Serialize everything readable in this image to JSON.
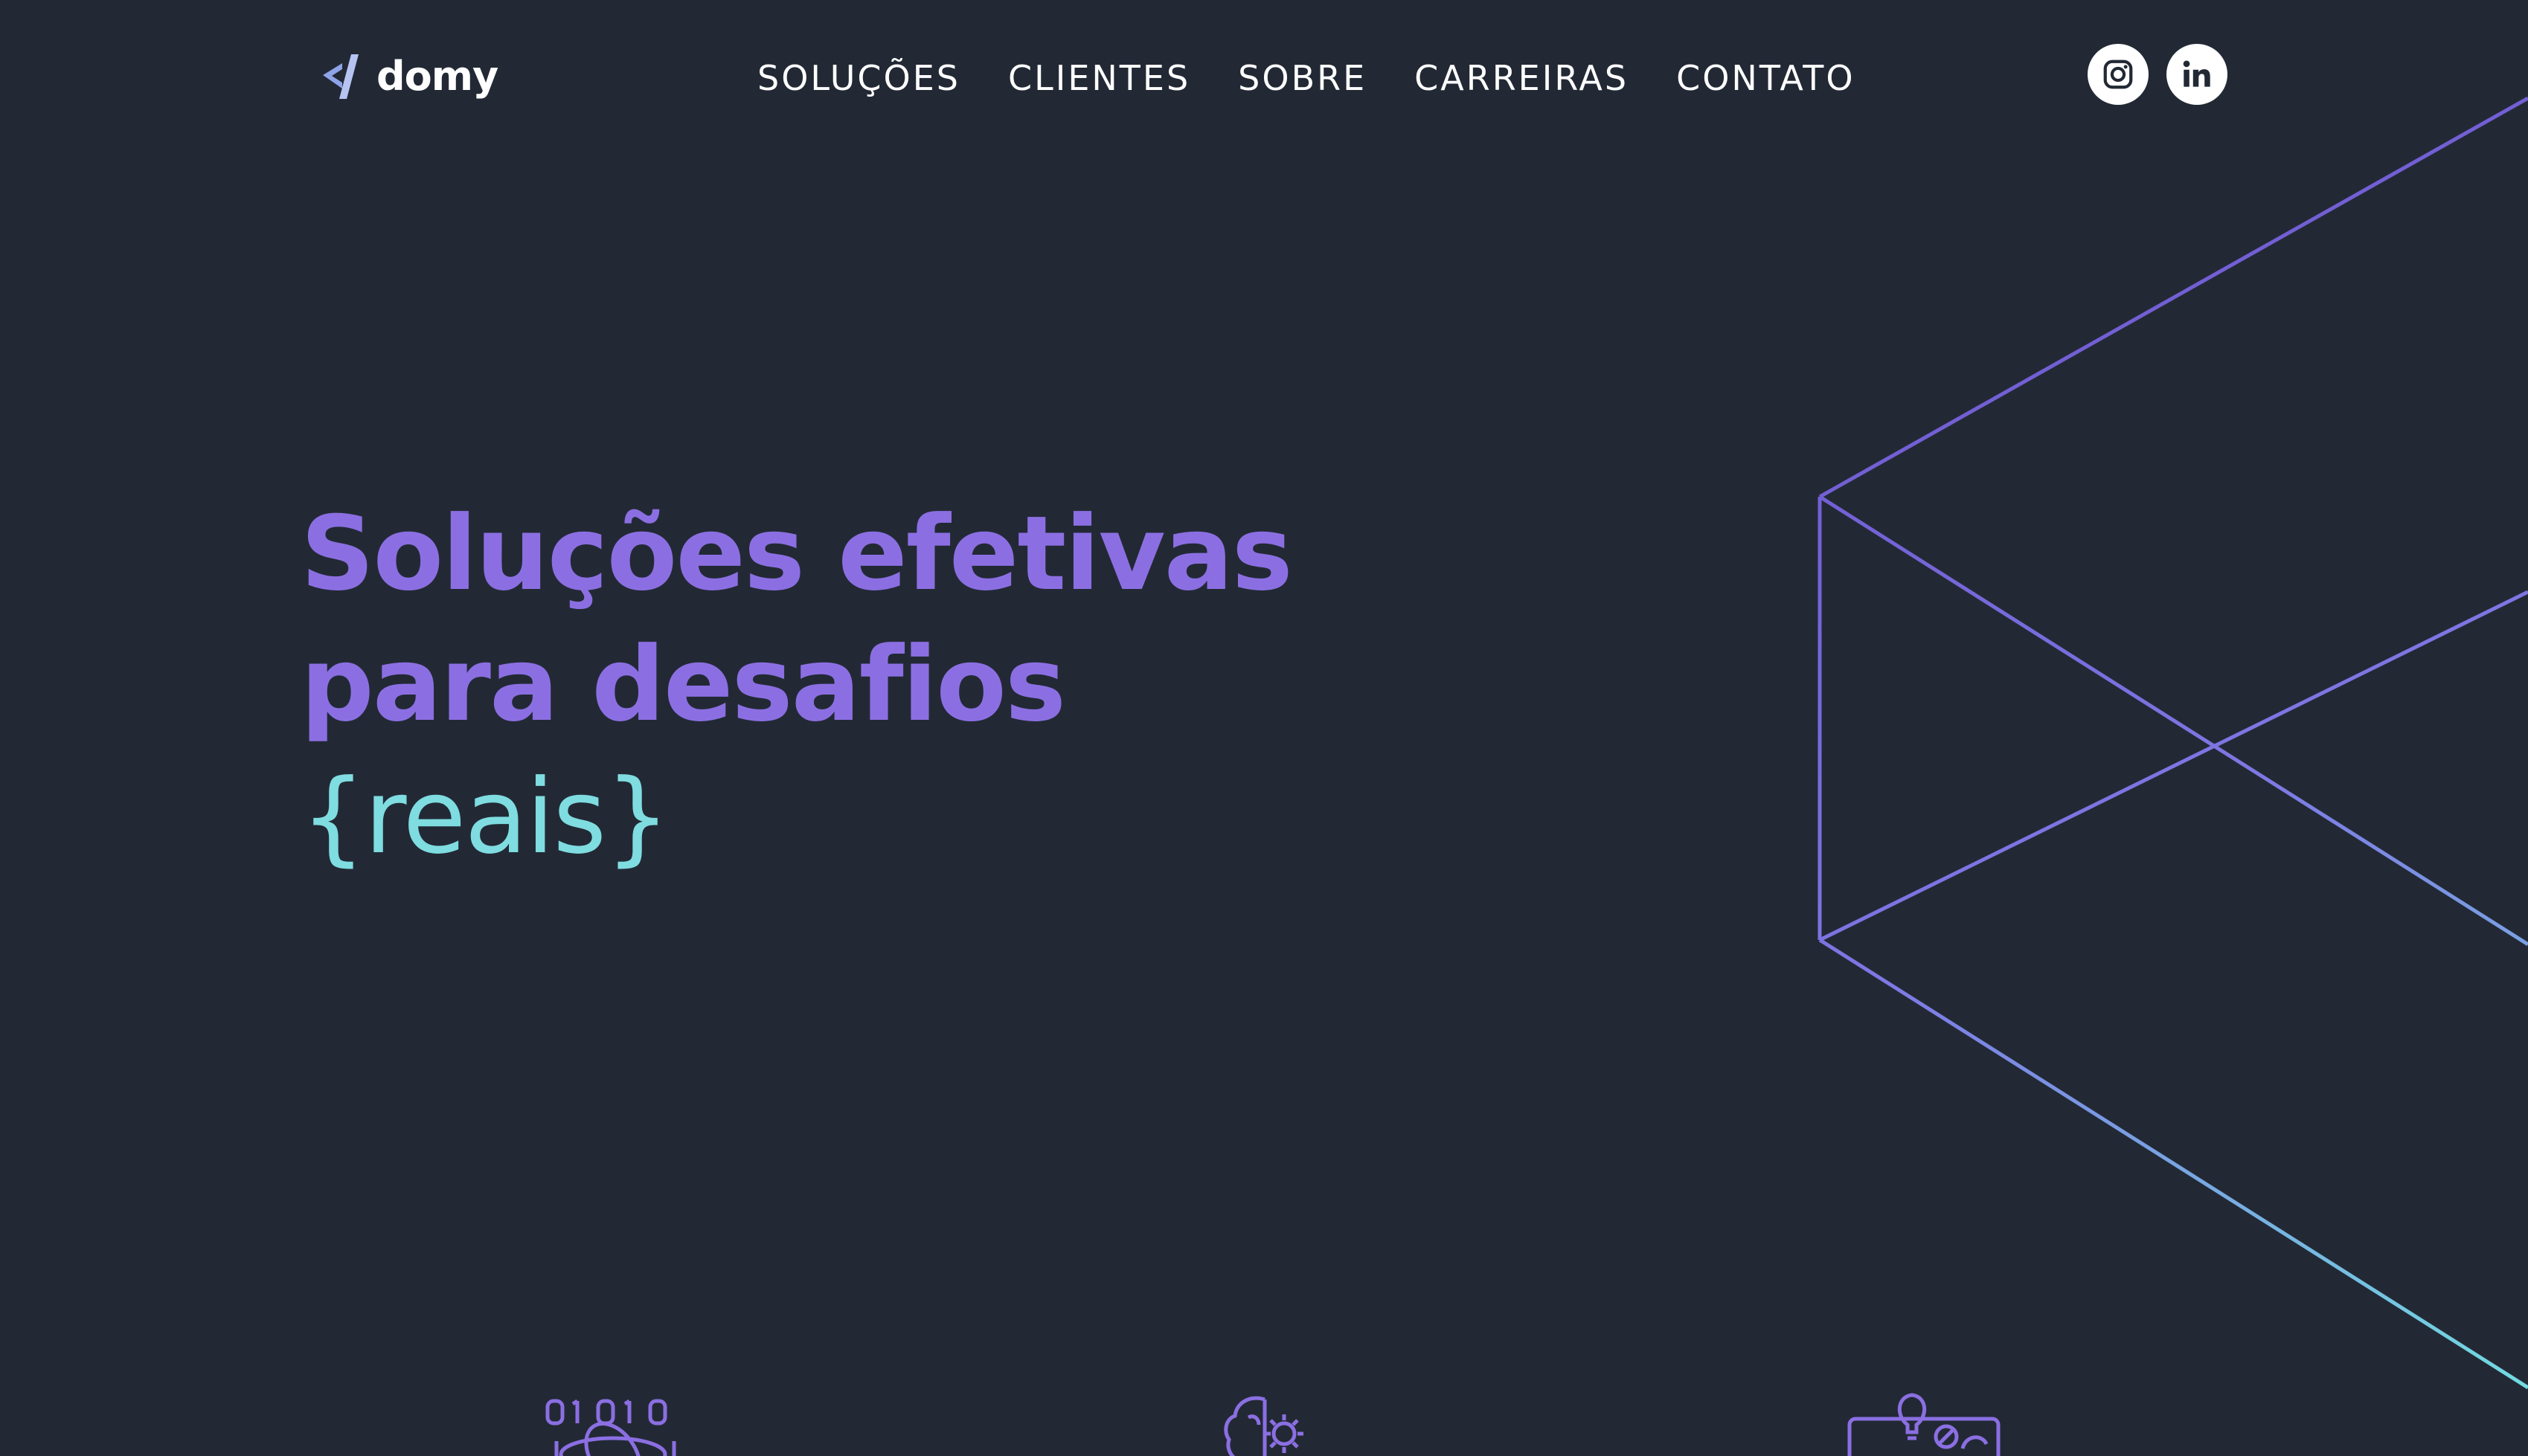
{
  "brand": {
    "name": "domy",
    "logo_icon": "code-bracket-logo-icon",
    "logo_colors": [
      "#8fa3e8",
      "#b6c4f2"
    ]
  },
  "nav": {
    "items": [
      {
        "label": "SOLUÇÕES"
      },
      {
        "label": "CLIENTES"
      },
      {
        "label": "SOBRE"
      },
      {
        "label": "CARREIRAS"
      },
      {
        "label": "CONTATO"
      }
    ]
  },
  "social": {
    "instagram_icon": "instagram-icon",
    "linkedin_icon": "linkedin-icon",
    "linkedin_text": "in"
  },
  "hero": {
    "line1": "Soluções efetivas",
    "line2": "para desafios",
    "line3": "{reais}",
    "color_primary": "#8b6fe2",
    "color_accent": "#7fdce0"
  },
  "features": {
    "icons": [
      {
        "icon": "binary-atom-icon"
      },
      {
        "icon": "brain-gear-icon"
      },
      {
        "icon": "lightbulb-laptop-icon"
      }
    ]
  },
  "theme": {
    "background": "#222935",
    "gradient_start": "#7a55d6",
    "gradient_end": "#75d8e0"
  }
}
